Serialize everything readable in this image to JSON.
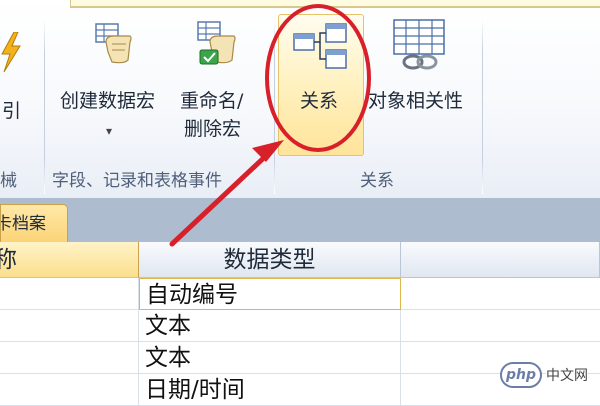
{
  "ribbon": {
    "partial_left_button": {
      "label": "引",
      "icon": "lightning-icon"
    },
    "buttons": [
      {
        "id": "create-data-macro",
        "label_line1": "创建数据宏",
        "label_line2": "▾",
        "icon": "data-macro-icon"
      },
      {
        "id": "rename-delete-macro",
        "label_line1": "重命名/",
        "label_line2": "删除宏",
        "icon": "rename-macro-icon"
      },
      {
        "id": "relationships",
        "label_line1": "关系",
        "icon": "relationships-icon",
        "highlighted": true
      },
      {
        "id": "object-dependencies",
        "label_line1": "对象相关性",
        "icon": "object-dependencies-icon"
      }
    ],
    "groups": [
      {
        "label": "械"
      },
      {
        "label": "字段、记录和表格事件"
      },
      {
        "label": "关系"
      }
    ]
  },
  "document_tab": {
    "label": "卡档案"
  },
  "table": {
    "columns": [
      {
        "label": "称"
      },
      {
        "label": "数据类型"
      },
      {
        "label": ""
      }
    ],
    "rows": [
      {
        "name": "",
        "type": "自动编号",
        "description": ""
      },
      {
        "name": "",
        "type": "文本",
        "description": ""
      },
      {
        "name": "",
        "type": "文本",
        "description": ""
      },
      {
        "name": "",
        "type": "日期/时间",
        "description": ""
      }
    ]
  },
  "watermark": {
    "badge": "php",
    "text": "中文网"
  },
  "colors": {
    "annotation": "#d8202a",
    "highlight": "#ffe49a",
    "ribbon_border": "#b8c6d9"
  }
}
